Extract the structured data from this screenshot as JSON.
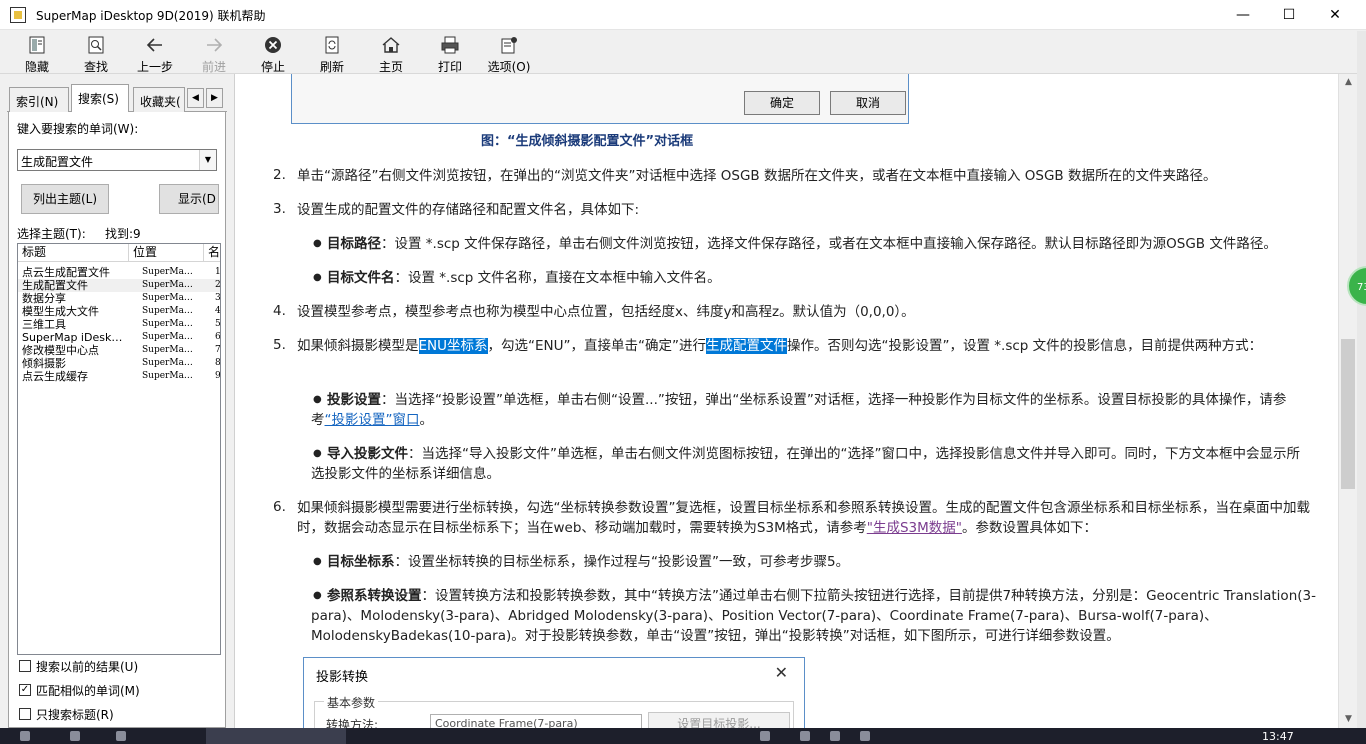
{
  "window": {
    "title": "SuperMap iDesktop 9D(2019) 联机帮助",
    "minimize": "—",
    "maximize": "☐",
    "close": "✕"
  },
  "toolbar": [
    {
      "label": "隐藏",
      "icon": "hide-icon"
    },
    {
      "label": "查找",
      "icon": "find-icon"
    },
    {
      "label": "上一步",
      "icon": "back-arrow-icon"
    },
    {
      "label": "前进",
      "icon": "forward-arrow-icon"
    },
    {
      "label": "停止",
      "icon": "stop-icon"
    },
    {
      "label": "刷新",
      "icon": "refresh-icon"
    },
    {
      "label": "主页",
      "icon": "home-icon"
    },
    {
      "label": "打印",
      "icon": "printer-icon"
    },
    {
      "label": "选项(O)",
      "icon": "options-icon"
    }
  ],
  "left": {
    "tabs": [
      "索引(N)",
      "搜索(S)",
      "收藏夹("
    ],
    "search_prompt": "键入要搜索的单词(W):",
    "search_value": "生成配置文件",
    "list_topics": "列出主题(L)",
    "display": "显示(D",
    "select_topic": "选择主题(T):",
    "found": "找到:9",
    "columns": [
      "标题",
      "位置",
      "名"
    ],
    "results": [
      {
        "title": "点云生成配置文件",
        "loc": "SuperMa…",
        "rank": "1"
      },
      {
        "title": "生成配置文件",
        "loc": "SuperMa…",
        "rank": "2"
      },
      {
        "title": "数据分享",
        "loc": "SuperMa…",
        "rank": "3"
      },
      {
        "title": "模型生成大文件",
        "loc": "SuperMa…",
        "rank": "4"
      },
      {
        "title": "三维工具",
        "loc": "SuperMa…",
        "rank": "5"
      },
      {
        "title": "SuperMap iDesk…",
        "loc": "SuperMa…",
        "rank": "6"
      },
      {
        "title": "修改模型中心点",
        "loc": "SuperMa…",
        "rank": "7"
      },
      {
        "title": "倾斜摄影",
        "loc": "SuperMa…",
        "rank": "8"
      },
      {
        "title": "点云生成缓存",
        "loc": "SuperMa…",
        "rank": "9"
      }
    ],
    "options": [
      {
        "label": "搜索以前的结果(U)",
        "checked": false
      },
      {
        "label": "匹配相似的单词(M)",
        "checked": true
      },
      {
        "label": "只搜索标题(R)",
        "checked": false
      }
    ]
  },
  "content": {
    "fig1_ok": "确定",
    "fig1_cancel": "取消",
    "fig1_caption": "图：“生成倾斜摄影配置文件”对话框",
    "item2_num": "2.",
    "item2": "单击“源路径”右侧文件浏览按钮，在弹出的“浏览文件夹”对话框中选择 OSGB 数据所在文件夹，或者在文本框中直接输入 OSGB 数据所在的文件夹路径。",
    "item3_num": "3.",
    "item3": "设置生成的配置文件的存储路径和配置文件名，具体如下:",
    "b1_bold": "目标路径",
    "b1_text": "：设置 *.scp 文件保存路径，单击右侧文件浏览按钮，选择文件保存路径，或者在文本框中直接输入保存路径。默认目标路径即为源OSGB 文件路径。",
    "b2_bold": "目标文件名",
    "b2_text": "：设置 *.scp 文件名称，直接在文本框中输入文件名。",
    "item4_num": "4.",
    "item4": "设置模型参考点，模型参考点也称为模型中心点位置，包括经度x、纬度y和高程z。默认值为（0,0,0）。",
    "item5_num": "5.",
    "item5_a": "如果倾斜摄影模型是",
    "item5_hl1": "ENU坐标系",
    "item5_b": "，勾选“ENU”，直接单击“确定”进行",
    "item5_hl2": "生成配置文件",
    "item5_c": "操作。否则勾选“投影设置”，设置 *.scp 文件的投影信息，目前提供两种方式：",
    "b3_bold": "投影设置",
    "b3_text": "：当选择“投影设置”单选框，单击右侧“设置...”按钮，弹出“坐标系设置”对话框，选择一种投影作为目标文件的坐标系。设置目标投影的具体操作，请参考",
    "b3_link": "“投影设置”窗口",
    "b3_end": "。",
    "b4_bold": "导入投影文件",
    "b4_text": "：当选择“导入投影文件”单选框，单击右侧文件浏览图标按钮，在弹出的“选择”窗口中，选择投影信息文件并导入即可。同时，下方文本框中会显示所选投影文件的坐标系详细信息。",
    "item6_num": "6.",
    "item6_a": "如果倾斜摄影模型需要进行坐标转换，勾选“坐标转换参数设置”复选框，设置目标坐标系和参照系转换设置。生成的配置文件包含源坐标系和目标坐标系，当在桌面中加载时，数据会动态显示在目标坐标系下；当在web、移动端加载时，需要转换为S3M格式，请参考",
    "item6_link": "\"生成S3M数据\"",
    "item6_b": "。参数设置具体如下：",
    "b5_bold": "目标坐标系",
    "b5_text": "：设置坐标转换的目标坐标系，操作过程与“投影设置”一致，可参考步骤5。",
    "b6_bold": "参照系转换设置",
    "b6_text": "：设置转换方法和投影转换参数，其中“转换方法”通过单击右侧下拉箭头按钮进行选择，目前提供7种转换方法，分别是：Geocentric Translation(3-para)、Molodensky(3-para)、Abridged Molodensky(3-para)、Position Vector(7-para)、Coordinate Frame(7-para)、Bursa-wolf(7-para)、MolodenskyBadekas(10-para)。对于投影转换参数，单击“设置”按钮，弹出“投影转换”对话框，如下图所示，可进行详细参数设置。",
    "fig2_title": "投影转换",
    "fig2_group": "基本参数",
    "fig2_method_label": "转换方法:",
    "fig2_method_value": "Coordinate Frame(7-para)",
    "fig2_button": "设置目标投影..."
  },
  "side_badge": "73",
  "taskbar": {
    "clock": "13:47"
  }
}
